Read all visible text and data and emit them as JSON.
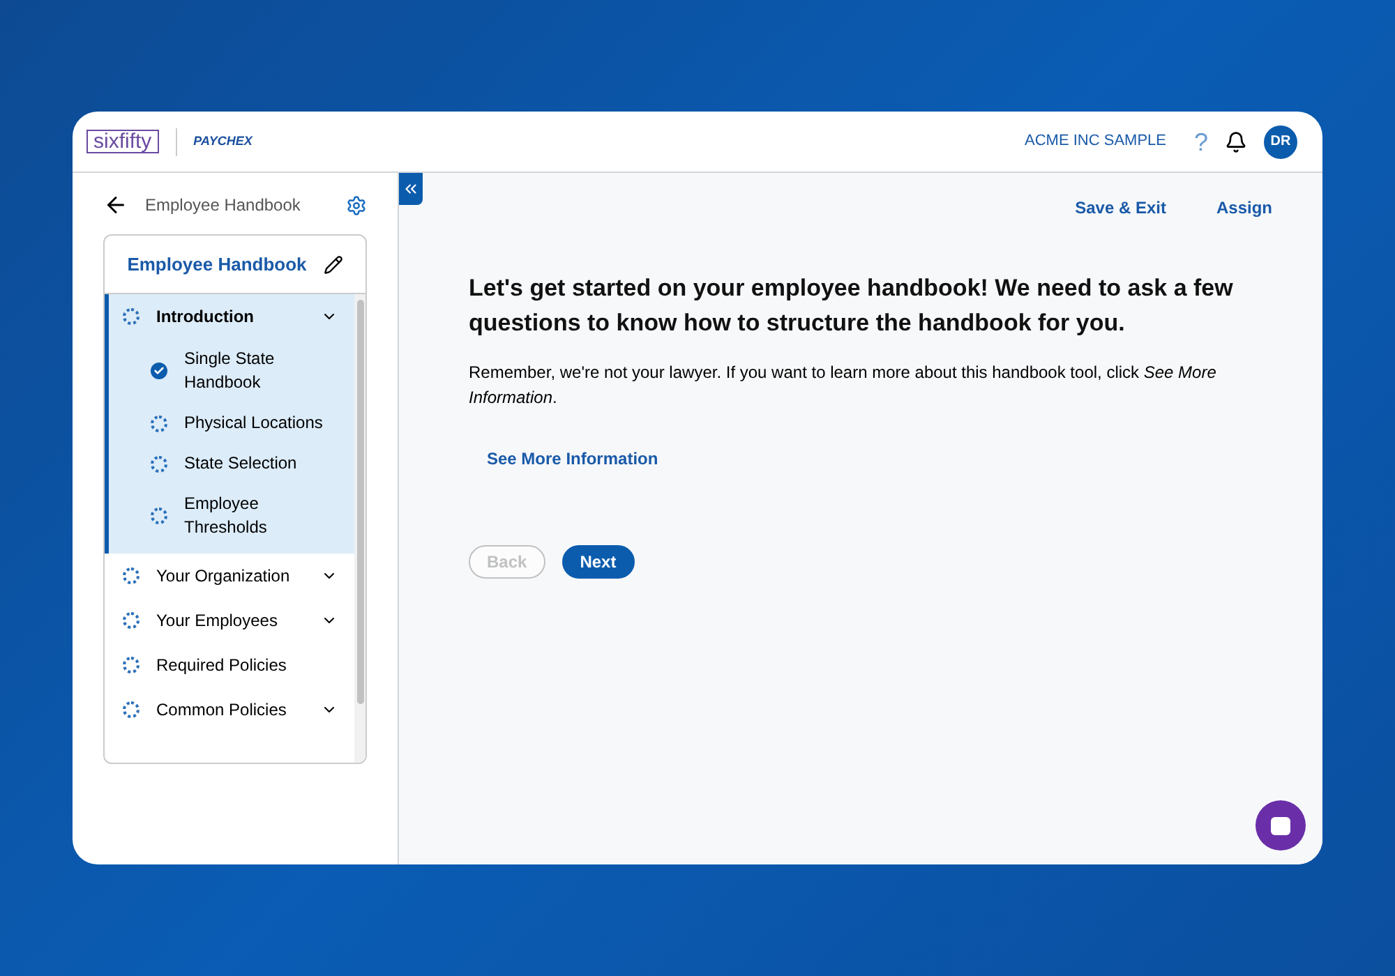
{
  "header": {
    "logo_primary": "sixfifty",
    "logo_partner": "PAYCHEX",
    "company": "ACME INC SAMPLE",
    "help": "?",
    "avatar": "DR"
  },
  "sidebar": {
    "back_label": "Employee Handbook",
    "card_title": "Employee Handbook",
    "items": [
      {
        "label": "Introduction",
        "done": false,
        "active": true,
        "expandable": true,
        "children": [
          {
            "label": "Single State Handbook",
            "done": true
          },
          {
            "label": "Physical Locations",
            "done": false
          },
          {
            "label": "State Selection",
            "done": false
          },
          {
            "label": "Employee Thresholds",
            "done": false
          }
        ]
      },
      {
        "label": "Your Organization",
        "done": false,
        "active": false,
        "expandable": true
      },
      {
        "label": "Your Employees",
        "done": false,
        "active": false,
        "expandable": true
      },
      {
        "label": "Required Policies",
        "done": false,
        "active": false,
        "expandable": false
      },
      {
        "label": "Common Policies",
        "done": false,
        "active": false,
        "expandable": true
      }
    ]
  },
  "toolbar": {
    "actions": [
      "Save & Exit",
      "Assign"
    ]
  },
  "main": {
    "heading": "Let's get started on your employee handbook! We need to ask a few questions to know how to structure the handbook for you.",
    "body": "Remember, we're not your lawyer. If you want to learn more about this handbook tool, click *See More Information*.",
    "link": "See More Information",
    "buttons": [
      {
        "label": "Back",
        "kind": "secondary",
        "disabled": true
      },
      {
        "label": "Next",
        "kind": "primary",
        "disabled": false
      }
    ]
  }
}
